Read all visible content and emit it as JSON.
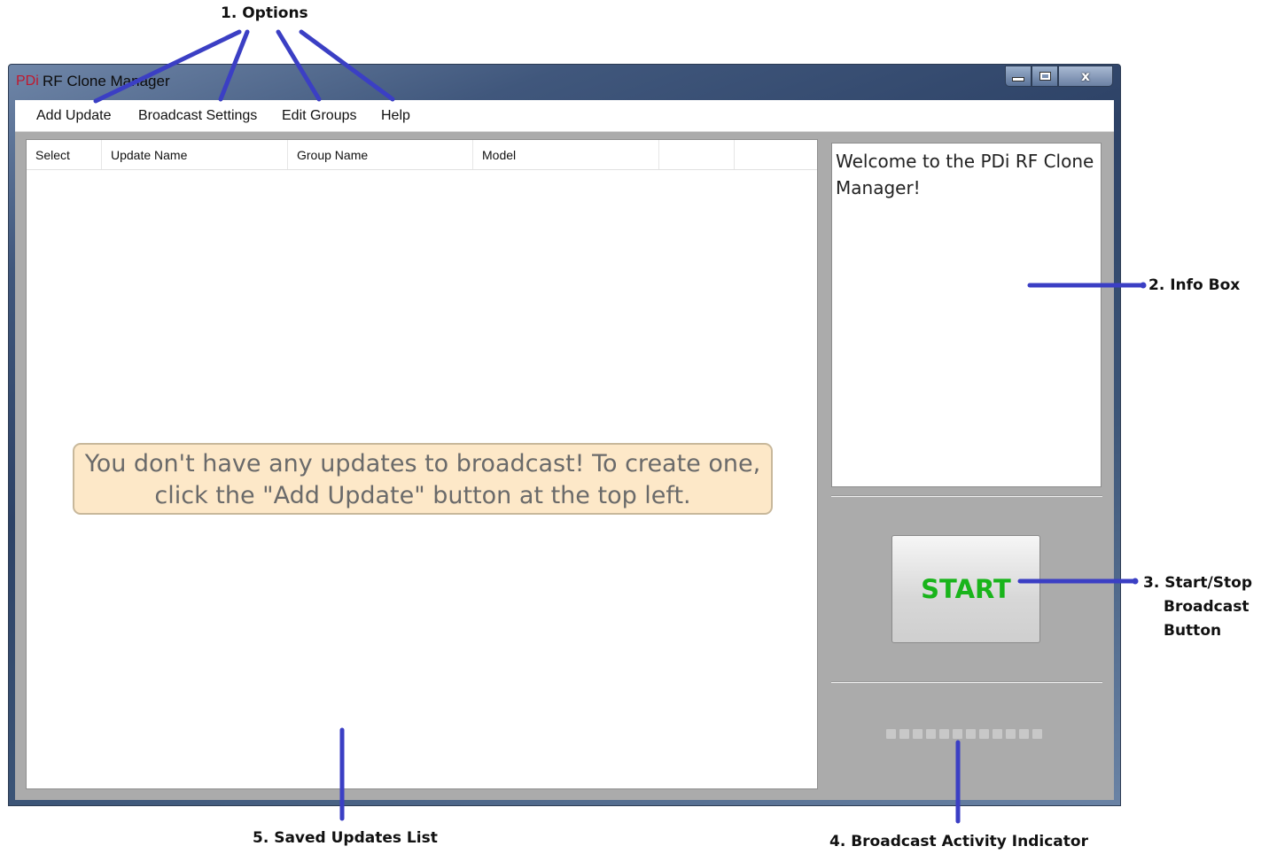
{
  "annotations": {
    "options": "1. Options",
    "info_box": "2. Info Box",
    "start_stop_l1": "3. Start/Stop",
    "start_stop_l2": "Broadcast",
    "start_stop_l3": "Button",
    "activity": "4. Broadcast Activity Indicator",
    "saved_list": "5. Saved Updates List",
    "color": "#3b3fc4"
  },
  "window": {
    "logo": "PDi",
    "title": "RF Clone Manager",
    "close_glyph": "x"
  },
  "menu": {
    "items": [
      "Add Update",
      "Broadcast Settings",
      "Edit Groups",
      "Help"
    ]
  },
  "list": {
    "columns": [
      "Select",
      "Update Name",
      "Group Name",
      "Model",
      "",
      ""
    ],
    "empty_message": "You don't have any updates to broadcast! To create one, click the \"Add Update\" button at the top left."
  },
  "info_box": {
    "text": "Welcome to the PDi RF Clone Manager!"
  },
  "start_button": {
    "label": "START",
    "color": "#19b41b"
  },
  "activity_indicator": {
    "led_count": 12,
    "active_count": 0
  }
}
